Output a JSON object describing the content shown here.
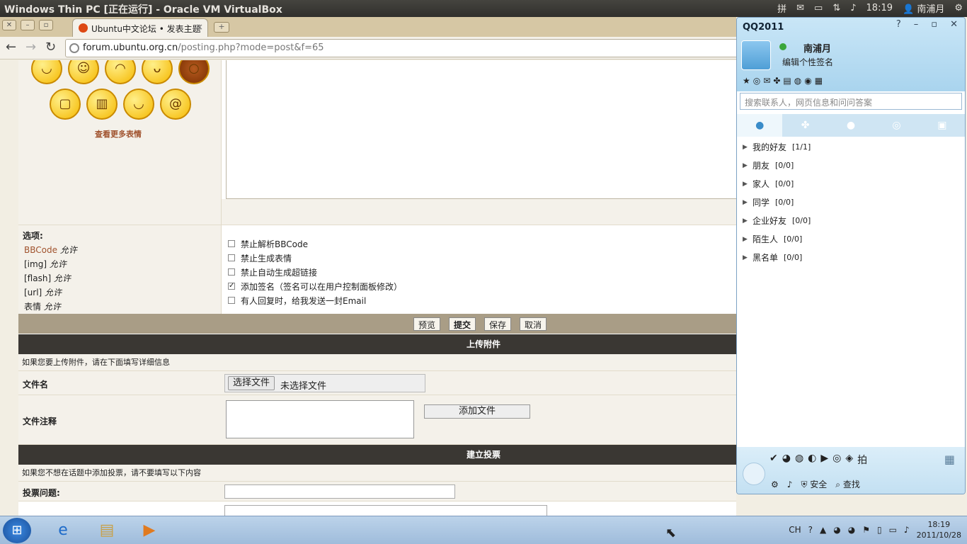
{
  "window": {
    "title": "Windows Thin PC [正在运行] - Oracle VM VirtualBox"
  },
  "ubuntu_tray": {
    "time": "18:19",
    "user": "南浦月"
  },
  "browser": {
    "tab_title": "Ubuntu中文论坛 • 发表主题",
    "url_host": "forum.ubuntu.org.cn",
    "url_path": "/posting.php?mode=post&f=65",
    "close": "×",
    "new_tab": "+"
  },
  "emoji": {
    "more_link": "查看更多表情"
  },
  "options": {
    "header": "选项:",
    "items": [
      {
        "name": "BBCode",
        "state": "允许"
      },
      {
        "name": "[img]",
        "state": "允许"
      },
      {
        "name": "[flash]",
        "state": "允许"
      },
      {
        "name": "[url]",
        "state": "允许"
      },
      {
        "name": "表情",
        "state": "允许"
      }
    ],
    "checkboxes": [
      {
        "label": "禁止解析BBCode",
        "checked": false
      },
      {
        "label": "禁止生成表情",
        "checked": false
      },
      {
        "label": "禁止自动生成超链接",
        "checked": false
      },
      {
        "label": "添加签名（签名可以在用户控制面板修改）",
        "checked": true
      },
      {
        "label": "有人回复时，给我发送一封Email",
        "checked": false
      }
    ]
  },
  "form_buttons": {
    "preview": "预览",
    "submit": "提交",
    "save": "保存",
    "cancel": "取消"
  },
  "upload": {
    "header": "上传附件",
    "hint": "如果您要上传附件，请在下面填写详细信息",
    "filename_label": "文件名",
    "choose_file": "选择文件",
    "no_file": "未选择文件",
    "comment_label": "文件注释",
    "add_file": "添加文件"
  },
  "poll": {
    "header": "建立投票",
    "hint": "如果您不想在话题中添加投票，请不要填写以下内容",
    "question_label": "投票问题:"
  },
  "qq": {
    "title": "QQ2011",
    "name": "南浦月",
    "signature": "编辑个性签名",
    "search_placeholder": "搜索联系人，网页信息和问问答案",
    "groups": [
      {
        "name": "我的好友",
        "count": "[1/1]"
      },
      {
        "name": "朋友",
        "count": "[0/0]"
      },
      {
        "name": "家人",
        "count": "[0/0]"
      },
      {
        "name": "同学",
        "count": "[0/0]"
      },
      {
        "name": "企业好友",
        "count": "[0/0]"
      },
      {
        "name": "陌生人",
        "count": "[0/0]"
      },
      {
        "name": "黑名单",
        "count": "[0/0]"
      }
    ],
    "security": "安全",
    "find": "查找"
  },
  "taskbar": {
    "lang": "CH",
    "time": "18:19",
    "date": "2011/10/28"
  }
}
